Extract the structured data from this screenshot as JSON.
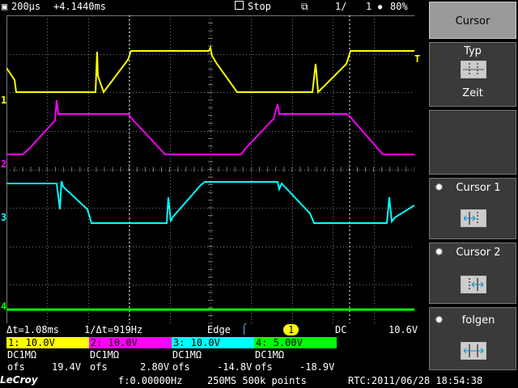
{
  "topbar": {
    "timebase": "200µs",
    "delay": "+4.1440ms",
    "run_state": "Stop",
    "page": "1/",
    "page_total": "1",
    "battery": "80%"
  },
  "menu": {
    "title": "Cursor",
    "typ_label": "Typ",
    "typ_value": "Zeit",
    "cursor1_label": "Cursor 1",
    "cursor2_label": "Cursor 2",
    "follow_label": "folgen"
  },
  "measure": {
    "delta_t": "Δt=1.08ms",
    "inv_delta_t": "1/Δt=919Hz",
    "trigger_type": "Edge",
    "trigger_channel": "1",
    "coupling": "DC",
    "trigger_level": "10.6V"
  },
  "channels": [
    {
      "label": "1: 10.0V",
      "coupling": "DC1MΩ",
      "ofs_label": "ofs",
      "offset": "19.4V",
      "color": "#ffff00",
      "marker": "1"
    },
    {
      "label": "2: 10.0V",
      "coupling": "DC1MΩ",
      "ofs_label": "ofs",
      "offset": "2.80V",
      "color": "#ff00ff",
      "marker": "2"
    },
    {
      "label": "3: 10.0V",
      "coupling": "DC1MΩ",
      "ofs_label": "ofs",
      "offset": "-14.8V",
      "color": "#00ffff",
      "marker": "3"
    },
    {
      "label": "4: 5.00V",
      "coupling": "DC1MΩ",
      "ofs_label": "ofs",
      "offset": "-18.9V",
      "color": "#00ff00",
      "marker": "4"
    }
  ],
  "footer": {
    "brand": "LeCroy",
    "frequency": "f:0.00000Hz",
    "sample": "250MS 500k points",
    "rtc": "RTC:2011/06/28 18:54:38"
  },
  "trigger_marker": "T",
  "colors": {
    "grid": "#808080",
    "menu_bg": "#3a3a3a",
    "menu_active": "#9a9a9a"
  }
}
